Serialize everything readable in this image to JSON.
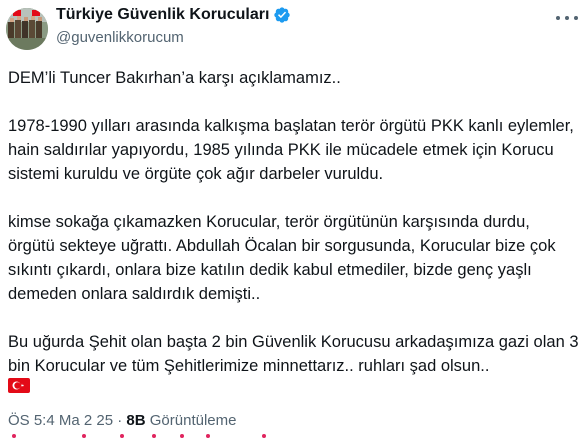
{
  "account": {
    "display_name": "Türkiye Güvenlik Korucuları",
    "handle": "@guvenlikkorucum",
    "verified": true,
    "avatar_icon": "group-photo-avatar"
  },
  "tweet": {
    "paragraphs": [
      "DEM’li Tuncer Bakırhan’a karşı açıklamamız..",
      "1978-1990 yılları arasında kalkışma başlatan terör örgütü PKK kanlı eylemler, hain saldırılar yapıyordu, 1985 yılında PKK ile mücadele etmek için Korucu sistemi kuruldu ve örgüte çok ağır darbeler vuruldu.",
      "kimse sokağa çıkamazken Korucular, terör örgütünün karşısında durdu, örgütü sekteye uğrattı. Abdullah Öcalan bir sorgusunda, Korucular bize çok sıkıntı çıkardı, onlara bize katılın dedik kabul etmediler, bizde genç yaşlı demeden onlara saldırdık demişti..",
      "Bu uğurda Şehit olan başta 2 bin Güvenlik Korucusu arkadaşımıza gazi olan 3 bin Korucular ve tüm Şehitlerimize minnettarız.. ruhları şad olsun.."
    ],
    "flag_emoji": "turkey-flag-icon"
  },
  "meta": {
    "time_date": "Ö​S 5:​4 M​a​ 2 ​25 ·",
    "views_count": "8​​B",
    "views_label": "Görüntüleme"
  },
  "colors": {
    "verified": "#1d9bf0",
    "secondary_text": "#536471",
    "flag_red": "#e30a17"
  }
}
